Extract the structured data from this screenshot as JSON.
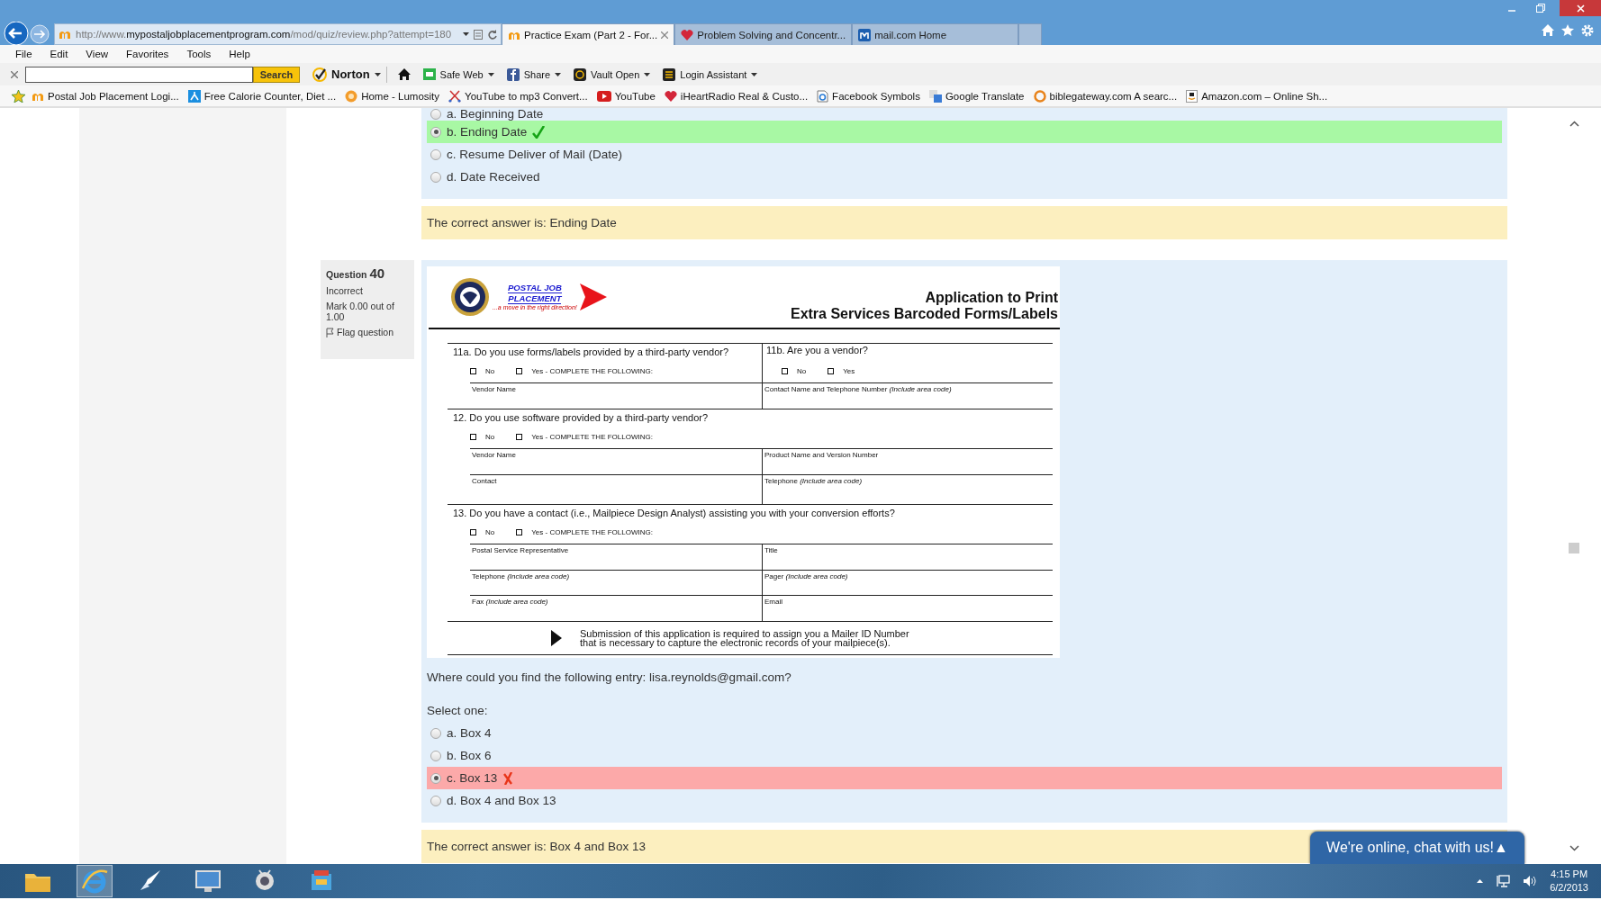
{
  "browser": {
    "address_bar": {
      "url": "http://www.**mypostaljobplacementprogram.com**/mod/quiz/review.php?attempt=180"
    },
    "tabs": [
      {
        "label": "Practice Exam (Part 2 - For...",
        "kind": "moodle",
        "selected": true
      },
      {
        "label": "Problem Solving and Concentr...",
        "kind": "heart",
        "selected": false
      },
      {
        "label": "mail.com Home",
        "kind": "mail",
        "selected": false
      }
    ],
    "menu": [
      "File",
      "Edit",
      "View",
      "Favorites",
      "Tools",
      "Help"
    ],
    "toolbar": {
      "search_button": "Search",
      "items": [
        {
          "label": "Norton",
          "kind": "norton",
          "dropdown": true
        },
        {
          "label": "Safe Web",
          "kind": "safeweb",
          "dropdown": true
        },
        {
          "label": "Share",
          "kind": "share",
          "dropdown": true
        },
        {
          "label": "Vault Open",
          "kind": "vault",
          "dropdown": true
        },
        {
          "label": "Login Assistant",
          "kind": "login",
          "dropdown": true
        }
      ]
    },
    "favorites": [
      {
        "label": "Postal Job Placement Logi...",
        "kind": "moodle"
      },
      {
        "label": "Free Calorie Counter, Diet ...",
        "kind": "calorie"
      },
      {
        "label": "Home - Lumosity",
        "kind": "lumosity"
      },
      {
        "label": "YouTube to mp3 Convert...",
        "kind": "cut"
      },
      {
        "label": "YouTube",
        "kind": "youtube"
      },
      {
        "label": "iHeartRadio  Real & Custo...",
        "kind": "heart"
      },
      {
        "label": "Facebook Symbols",
        "kind": "page"
      },
      {
        "label": "Google Translate",
        "kind": "translate"
      },
      {
        "label": "biblegateway.com A searc...",
        "kind": "bible"
      },
      {
        "label": "Amazon.com – Online Sh...",
        "kind": "amazon"
      }
    ]
  },
  "quiz": {
    "previous_question": {
      "answers": [
        {
          "label": "a. Beginning Date",
          "selected": false
        },
        {
          "label": "b. Ending Date",
          "selected": true,
          "correct": true
        },
        {
          "label": "c. Resume Deliver of Mail (Date)",
          "selected": false
        },
        {
          "label": "d. Date Received",
          "selected": false
        }
      ],
      "feedback": "The correct answer is: Ending Date"
    },
    "question": {
      "label": "Question",
      "number": "40",
      "state": "Incorrect",
      "mark": "Mark 0.00 out of 1.00",
      "flag": "Flag question",
      "document": {
        "logo": {
          "line1": "POSTAL JOB",
          "line2": "PLACEMENT",
          "tagline": "...a move in the right direction!"
        },
        "title": [
          "Application to Print",
          "Extra Services Barcoded Forms/Labels"
        ],
        "sections": [
          {
            "kind": "split",
            "columns": [
              {
                "question": "11a. Do you use forms/labels provided by a third-party vendor?",
                "options": [
                  {
                    "label": "No",
                    "checked": false
                  },
                  {
                    "label": "Yes - COMPLETE THE FOLLOWING:",
                    "checked": false
                  }
                ],
                "fields": [
                  "Vendor Name"
                ]
              },
              {
                "question": "11b. Are you a vendor?",
                "options": [
                  {
                    "label": "No",
                    "checked": false
                  },
                  {
                    "label": "Yes",
                    "checked": false
                  }
                ],
                "fields": [
                  "Contact Name and Telephone Number *(Include area code)*"
                ]
              }
            ]
          },
          {
            "kind": "full",
            "question": "12. Do you use software provided by a third-party vendor?",
            "options": [
              {
                "label": "No",
                "checked": false
              },
              {
                "label": "Yes - COMPLETE THE FOLLOWING:",
                "checked": false
              }
            ],
            "fields": [
              "Vendor Name",
              "Product Name and Version Number",
              "Contact",
              "Telephone *(Include area code)*"
            ]
          },
          {
            "kind": "full",
            "question": "13. Do you have a contact (i.e., Mailpiece Design Analyst) assisting you with your conversion efforts?",
            "options": [
              {
                "label": "No",
                "checked": false
              },
              {
                "label": "Yes - COMPLETE THE FOLLOWING:",
                "checked": false
              }
            ],
            "fields": [
              "Postal Service Representative",
              "Title",
              "Telephone *(Include area code)*",
              "Pager *(Include area code)*",
              "Fax *(Include area code)*",
              "Email"
            ]
          }
        ],
        "notice": [
          "Submission of this application is required to assign you a Mailer ID Number",
          "that is necessary to capture the electronic records of your mailpiece(s)."
        ]
      },
      "text": "Where could you find the following entry: lisa.reynolds@gmail.com?",
      "prompt": "Select one:",
      "answers": [
        {
          "label": "a. Box 4",
          "selected": false
        },
        {
          "label": "b. Box 6",
          "selected": false
        },
        {
          "label": "c. Box 13",
          "selected": true,
          "correct": false
        },
        {
          "label": "d. Box 4 and Box 13",
          "selected": false
        }
      ],
      "feedback": "The correct answer is: Box 4 and Box 13"
    }
  },
  "chat_button": "We're online, chat with us!▲",
  "taskbar": {
    "apps": [
      {
        "kind": "explorer",
        "active": false
      },
      {
        "kind": "ie",
        "active": true
      },
      {
        "kind": "rocket",
        "active": false
      },
      {
        "kind": "monitor",
        "active": false
      },
      {
        "kind": "robot",
        "active": false
      },
      {
        "kind": "tools",
        "active": false
      }
    ],
    "time": "4:15 PM",
    "date": "6/2/2013"
  }
}
